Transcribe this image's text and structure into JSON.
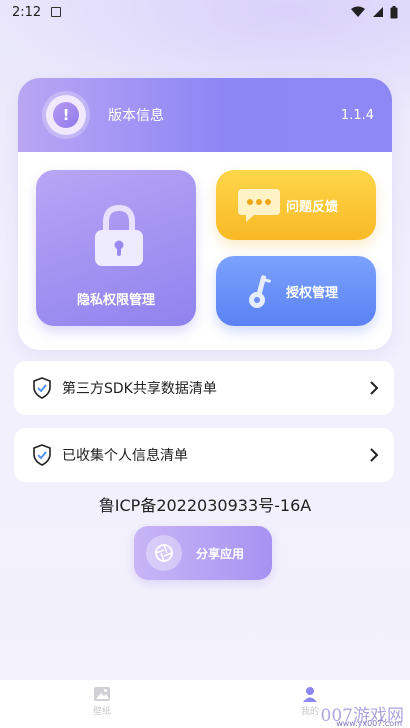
{
  "status_bar": {
    "time": "2:12"
  },
  "card": {
    "title": "版本信息",
    "version": "1.1.4",
    "info_symbol": "!",
    "tiles": {
      "privacy": "隐私权限管理",
      "feedback": "问题反馈",
      "auth": "授权管理"
    }
  },
  "list": [
    {
      "text": "第三方SDK共享数据清单"
    },
    {
      "text": "已收集个人信息清单"
    }
  ],
  "icp": "鲁ICP备2022030933号-16A",
  "share": {
    "label": "分享应用"
  },
  "bottom_nav": {
    "wallpaper": "壁纸",
    "mine": "我的"
  },
  "watermark": {
    "brand": "007游戏网",
    "url": "www.yx007.com"
  },
  "colors": {
    "accent_purple": "#8d86f5",
    "feedback_yellow": "#f8b925",
    "auth_blue": "#5b82f4"
  },
  "icons": [
    "info-icon",
    "lock-icon",
    "chat-icon",
    "key-icon",
    "shield-check-icon",
    "chevron-right-icon",
    "camera-aperture-icon",
    "image-icon"
  ]
}
